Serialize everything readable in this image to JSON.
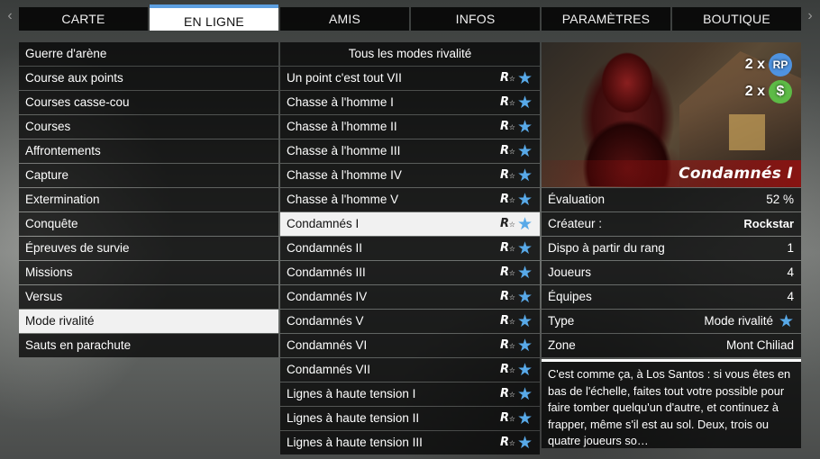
{
  "nav": {
    "arrow_left": "‹",
    "arrow_right": "›",
    "tabs": [
      "CARTE",
      "EN LIGNE",
      "AMIS",
      "INFOS",
      "PARAMÈTRES",
      "BOUTIQUE"
    ],
    "active_tab": "EN LIGNE",
    "accent_color": "#5d9fe0"
  },
  "categories": {
    "items": [
      "Guerre d'arène",
      "Course aux points",
      "Courses casse-cou",
      "Courses",
      "Affrontements",
      "Capture",
      "Extermination",
      "Conquête",
      "Épreuves de survie",
      "Missions",
      "Versus",
      "Mode rivalité",
      "Sauts en parachute"
    ],
    "selected": "Mode rivalité"
  },
  "mode_list": {
    "header": "Tous les modes rivalité",
    "items": [
      "Un point c'est tout VII",
      "Chasse à l'homme I",
      "Chasse à l'homme II",
      "Chasse à l'homme III",
      "Chasse à l'homme IV",
      "Chasse à l'homme V",
      "Condamnés I",
      "Condamnés II",
      "Condamnés III",
      "Condamnés IV",
      "Condamnés V",
      "Condamnés VI",
      "Condamnés VII",
      "Lignes à haute tension I",
      "Lignes à haute tension II",
      "Lignes à haute tension III"
    ],
    "selected": "Condamnés I",
    "row_icons": [
      "rockstar-verified-icon",
      "star-icon"
    ],
    "star_color": "#58a9e8"
  },
  "detail": {
    "multipliers": {
      "rp_label": "2 x",
      "rp_badge": "RP",
      "cash_label": "2 x",
      "cash_badge": "$",
      "rp_color": "#4f93e0",
      "cash_color": "#5dbb46"
    },
    "title": "Condamnés I",
    "rows": [
      {
        "label": "Évaluation",
        "value": "52 %"
      },
      {
        "label": "Créateur :",
        "value": "Rockstar"
      },
      {
        "label": "Dispo à partir du rang",
        "value": "1"
      },
      {
        "label": "Joueurs",
        "value": "4"
      },
      {
        "label": "Équipes",
        "value": "4"
      },
      {
        "label": "Type",
        "value": "Mode rivalité"
      },
      {
        "label": "Zone",
        "value": "Mont Chiliad"
      }
    ],
    "description": "C'est comme ça, à Los Santos : si vous êtes en bas de l'échelle, faites tout votre possible pour faire tomber quelqu'un d'autre, et continuez à frapper, même s'il est au sol. Deux, trois ou quatre joueurs so…"
  }
}
